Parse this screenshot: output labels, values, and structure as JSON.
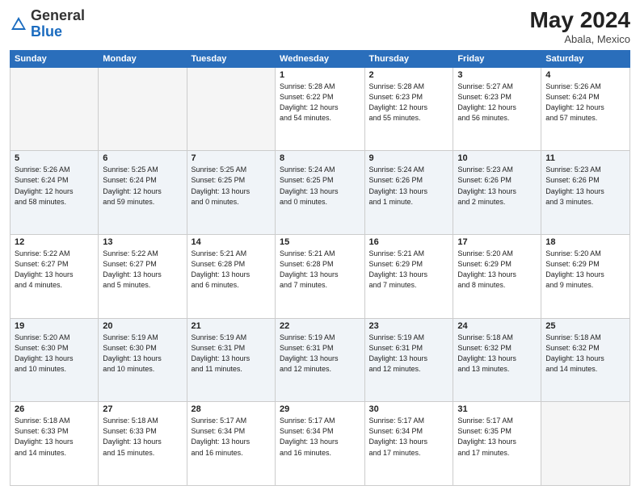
{
  "header": {
    "logo_general": "General",
    "logo_blue": "Blue",
    "month_year": "May 2024",
    "location": "Abala, Mexico"
  },
  "days_of_week": [
    "Sunday",
    "Monday",
    "Tuesday",
    "Wednesday",
    "Thursday",
    "Friday",
    "Saturday"
  ],
  "weeks": [
    [
      {
        "day": "",
        "info": ""
      },
      {
        "day": "",
        "info": ""
      },
      {
        "day": "",
        "info": ""
      },
      {
        "day": "1",
        "info": "Sunrise: 5:28 AM\nSunset: 6:22 PM\nDaylight: 12 hours\nand 54 minutes."
      },
      {
        "day": "2",
        "info": "Sunrise: 5:28 AM\nSunset: 6:23 PM\nDaylight: 12 hours\nand 55 minutes."
      },
      {
        "day": "3",
        "info": "Sunrise: 5:27 AM\nSunset: 6:23 PM\nDaylight: 12 hours\nand 56 minutes."
      },
      {
        "day": "4",
        "info": "Sunrise: 5:26 AM\nSunset: 6:24 PM\nDaylight: 12 hours\nand 57 minutes."
      }
    ],
    [
      {
        "day": "5",
        "info": "Sunrise: 5:26 AM\nSunset: 6:24 PM\nDaylight: 12 hours\nand 58 minutes."
      },
      {
        "day": "6",
        "info": "Sunrise: 5:25 AM\nSunset: 6:24 PM\nDaylight: 12 hours\nand 59 minutes."
      },
      {
        "day": "7",
        "info": "Sunrise: 5:25 AM\nSunset: 6:25 PM\nDaylight: 13 hours\nand 0 minutes."
      },
      {
        "day": "8",
        "info": "Sunrise: 5:24 AM\nSunset: 6:25 PM\nDaylight: 13 hours\nand 0 minutes."
      },
      {
        "day": "9",
        "info": "Sunrise: 5:24 AM\nSunset: 6:26 PM\nDaylight: 13 hours\nand 1 minute."
      },
      {
        "day": "10",
        "info": "Sunrise: 5:23 AM\nSunset: 6:26 PM\nDaylight: 13 hours\nand 2 minutes."
      },
      {
        "day": "11",
        "info": "Sunrise: 5:23 AM\nSunset: 6:26 PM\nDaylight: 13 hours\nand 3 minutes."
      }
    ],
    [
      {
        "day": "12",
        "info": "Sunrise: 5:22 AM\nSunset: 6:27 PM\nDaylight: 13 hours\nand 4 minutes."
      },
      {
        "day": "13",
        "info": "Sunrise: 5:22 AM\nSunset: 6:27 PM\nDaylight: 13 hours\nand 5 minutes."
      },
      {
        "day": "14",
        "info": "Sunrise: 5:21 AM\nSunset: 6:28 PM\nDaylight: 13 hours\nand 6 minutes."
      },
      {
        "day": "15",
        "info": "Sunrise: 5:21 AM\nSunset: 6:28 PM\nDaylight: 13 hours\nand 7 minutes."
      },
      {
        "day": "16",
        "info": "Sunrise: 5:21 AM\nSunset: 6:29 PM\nDaylight: 13 hours\nand 7 minutes."
      },
      {
        "day": "17",
        "info": "Sunrise: 5:20 AM\nSunset: 6:29 PM\nDaylight: 13 hours\nand 8 minutes."
      },
      {
        "day": "18",
        "info": "Sunrise: 5:20 AM\nSunset: 6:29 PM\nDaylight: 13 hours\nand 9 minutes."
      }
    ],
    [
      {
        "day": "19",
        "info": "Sunrise: 5:20 AM\nSunset: 6:30 PM\nDaylight: 13 hours\nand 10 minutes."
      },
      {
        "day": "20",
        "info": "Sunrise: 5:19 AM\nSunset: 6:30 PM\nDaylight: 13 hours\nand 10 minutes."
      },
      {
        "day": "21",
        "info": "Sunrise: 5:19 AM\nSunset: 6:31 PM\nDaylight: 13 hours\nand 11 minutes."
      },
      {
        "day": "22",
        "info": "Sunrise: 5:19 AM\nSunset: 6:31 PM\nDaylight: 13 hours\nand 12 minutes."
      },
      {
        "day": "23",
        "info": "Sunrise: 5:19 AM\nSunset: 6:31 PM\nDaylight: 13 hours\nand 12 minutes."
      },
      {
        "day": "24",
        "info": "Sunrise: 5:18 AM\nSunset: 6:32 PM\nDaylight: 13 hours\nand 13 minutes."
      },
      {
        "day": "25",
        "info": "Sunrise: 5:18 AM\nSunset: 6:32 PM\nDaylight: 13 hours\nand 14 minutes."
      }
    ],
    [
      {
        "day": "26",
        "info": "Sunrise: 5:18 AM\nSunset: 6:33 PM\nDaylight: 13 hours\nand 14 minutes."
      },
      {
        "day": "27",
        "info": "Sunrise: 5:18 AM\nSunset: 6:33 PM\nDaylight: 13 hours\nand 15 minutes."
      },
      {
        "day": "28",
        "info": "Sunrise: 5:17 AM\nSunset: 6:34 PM\nDaylight: 13 hours\nand 16 minutes."
      },
      {
        "day": "29",
        "info": "Sunrise: 5:17 AM\nSunset: 6:34 PM\nDaylight: 13 hours\nand 16 minutes."
      },
      {
        "day": "30",
        "info": "Sunrise: 5:17 AM\nSunset: 6:34 PM\nDaylight: 13 hours\nand 17 minutes."
      },
      {
        "day": "31",
        "info": "Sunrise: 5:17 AM\nSunset: 6:35 PM\nDaylight: 13 hours\nand 17 minutes."
      },
      {
        "day": "",
        "info": ""
      }
    ]
  ]
}
